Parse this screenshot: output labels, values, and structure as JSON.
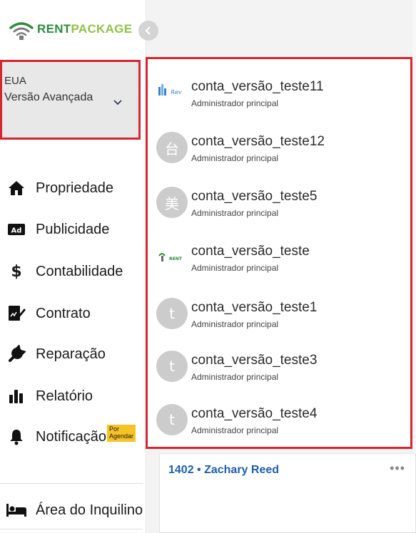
{
  "brand": {
    "rent": "RENT",
    "package": "PACKAGE",
    "rent_color": "#2e8a3d",
    "package_color": "#8fc24b"
  },
  "account_switch": {
    "region": "EUA",
    "plan": "Versão Avançada"
  },
  "menu": [
    {
      "label": "Propriedade",
      "icon": "home-icon"
    },
    {
      "label": "Publicidade",
      "icon": "ad-icon"
    },
    {
      "label": "Contabilidade",
      "icon": "dollar-icon"
    },
    {
      "label": "Contrato",
      "icon": "contract-icon"
    },
    {
      "label": "Reparação",
      "icon": "wrench-icon"
    },
    {
      "label": "Relatório",
      "icon": "bar-chart-icon"
    },
    {
      "label": "Notificação",
      "icon": "bell-icon",
      "badge": "Por Agendar"
    }
  ],
  "tenant_area": {
    "label": "Área do Inquilino",
    "icon": "bed-icon"
  },
  "accounts": [
    {
      "name": "conta_versão_teste11",
      "role": "Administrador principal",
      "avatar": "image"
    },
    {
      "name": "conta_versão_teste12",
      "role": "Administrador principal",
      "avatar": "台"
    },
    {
      "name": "conta_versão_teste5",
      "role": "Administrador principal",
      "avatar": "美"
    },
    {
      "name": "conta_versão_teste",
      "role": "Administrador principal",
      "avatar": "logo"
    },
    {
      "name": "conta_versão_teste1",
      "role": "Administrador principal",
      "avatar": "t"
    },
    {
      "name": "conta_versão_teste3",
      "role": "Administrador principal",
      "avatar": "t"
    },
    {
      "name": "conta_versão_teste4",
      "role": "Administrador principal",
      "avatar": "t"
    }
  ],
  "background_card": {
    "title": "1402 • Zachary Reed",
    "more": "•••"
  },
  "highlight_color": "#d6262f",
  "badge_color": "#f6c224"
}
